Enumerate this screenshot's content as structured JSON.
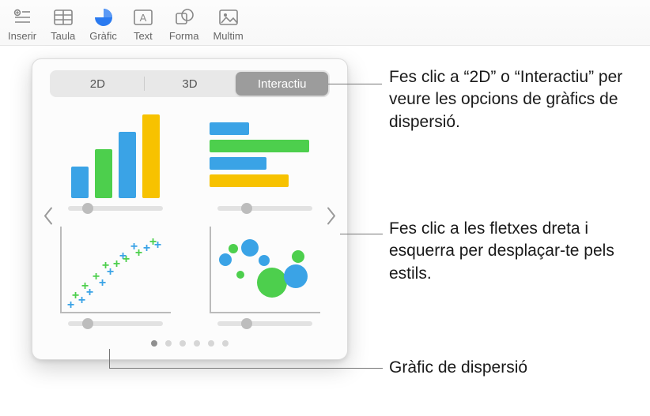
{
  "toolbar": {
    "items": [
      {
        "label": "Inserir"
      },
      {
        "label": "Taula"
      },
      {
        "label": "Gràfic"
      },
      {
        "label": "Text"
      },
      {
        "label": "Forma"
      },
      {
        "label": "Multim"
      }
    ]
  },
  "segments": {
    "items": [
      "2D",
      "3D",
      "Interactiu"
    ],
    "selected_index": 2
  },
  "callouts": {
    "top": "Fes clic a “2D” o “Interactiu” per veure les opcions de gràfics de dispersió.",
    "mid": "Fes clic a les fletxes dreta i esquerra per desplaçar-te pels estils.",
    "bottom": "Gràfic de dispersió"
  },
  "colors": {
    "blue": "#3aa3e6",
    "green": "#4dcf4d",
    "yellow": "#f7c200",
    "selected_seg": "#9c9c9c"
  },
  "chart_data": [
    {
      "type": "bar",
      "orientation": "vertical",
      "colors": [
        "blue",
        "green",
        "blue",
        "yellow"
      ],
      "values": [
        40,
        62,
        84,
        106
      ]
    },
    {
      "type": "bar",
      "orientation": "horizontal",
      "colors": [
        "blue",
        "green",
        "blue",
        "yellow"
      ],
      "values": [
        50,
        126,
        72,
        100
      ]
    },
    {
      "type": "scatter"
    },
    {
      "type": "bubble"
    }
  ],
  "pager": {
    "count": 6,
    "active": 0
  }
}
